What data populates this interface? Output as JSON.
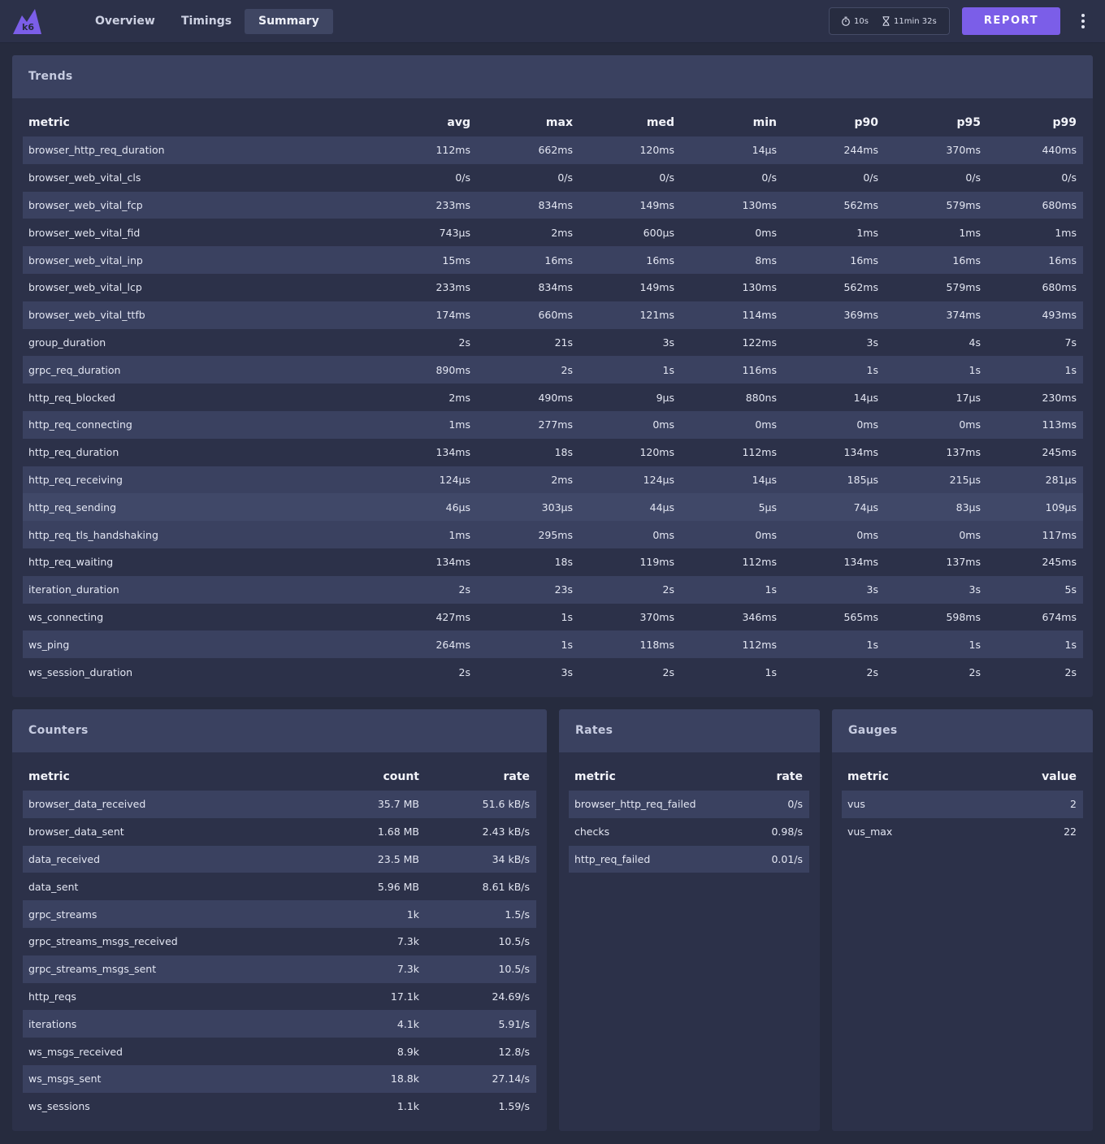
{
  "header": {
    "tabs": [
      "Overview",
      "Timings",
      "Summary"
    ],
    "active_tab": "Summary",
    "refresh_interval": "10s",
    "duration": "11min 32s",
    "report_label": "REPORT",
    "logo_text": "k6",
    "accent_color": "#7b5ee8"
  },
  "trends": {
    "title": "Trends",
    "columns": [
      "metric",
      "avg",
      "max",
      "med",
      "min",
      "p90",
      "p95",
      "p99"
    ],
    "rows": [
      [
        "browser_http_req_duration",
        "112ms",
        "662ms",
        "120ms",
        "14µs",
        "244ms",
        "370ms",
        "440ms"
      ],
      [
        "browser_web_vital_cls",
        "0/s",
        "0/s",
        "0/s",
        "0/s",
        "0/s",
        "0/s",
        "0/s"
      ],
      [
        "browser_web_vital_fcp",
        "233ms",
        "834ms",
        "149ms",
        "130ms",
        "562ms",
        "579ms",
        "680ms"
      ],
      [
        "browser_web_vital_fid",
        "743µs",
        "2ms",
        "600µs",
        "0ms",
        "1ms",
        "1ms",
        "1ms"
      ],
      [
        "browser_web_vital_inp",
        "15ms",
        "16ms",
        "16ms",
        "8ms",
        "16ms",
        "16ms",
        "16ms"
      ],
      [
        "browser_web_vital_lcp",
        "233ms",
        "834ms",
        "149ms",
        "130ms",
        "562ms",
        "579ms",
        "680ms"
      ],
      [
        "browser_web_vital_ttfb",
        "174ms",
        "660ms",
        "121ms",
        "114ms",
        "369ms",
        "374ms",
        "493ms"
      ],
      [
        "group_duration",
        "2s",
        "21s",
        "3s",
        "122ms",
        "3s",
        "4s",
        "7s"
      ],
      [
        "grpc_req_duration",
        "890ms",
        "2s",
        "1s",
        "116ms",
        "1s",
        "1s",
        "1s"
      ],
      [
        "http_req_blocked",
        "2ms",
        "490ms",
        "9µs",
        "880ns",
        "14µs",
        "17µs",
        "230ms"
      ],
      [
        "http_req_connecting",
        "1ms",
        "277ms",
        "0ms",
        "0ms",
        "0ms",
        "0ms",
        "113ms"
      ],
      [
        "http_req_duration",
        "134ms",
        "18s",
        "120ms",
        "112ms",
        "134ms",
        "137ms",
        "245ms"
      ],
      [
        "http_req_receiving",
        "124µs",
        "2ms",
        "124µs",
        "14µs",
        "185µs",
        "215µs",
        "281µs"
      ],
      [
        "http_req_sending",
        "46µs",
        "303µs",
        "44µs",
        "5µs",
        "74µs",
        "83µs",
        "109µs"
      ],
      [
        "http_req_tls_handshaking",
        "1ms",
        "295ms",
        "0ms",
        "0ms",
        "0ms",
        "0ms",
        "117ms"
      ],
      [
        "http_req_waiting",
        "134ms",
        "18s",
        "119ms",
        "112ms",
        "134ms",
        "137ms",
        "245ms"
      ],
      [
        "iteration_duration",
        "2s",
        "23s",
        "2s",
        "1s",
        "3s",
        "3s",
        "5s"
      ],
      [
        "ws_connecting",
        "427ms",
        "1s",
        "370ms",
        "346ms",
        "565ms",
        "598ms",
        "674ms"
      ],
      [
        "ws_ping",
        "264ms",
        "1s",
        "118ms",
        "112ms",
        "1s",
        "1s",
        "1s"
      ],
      [
        "ws_session_duration",
        "2s",
        "3s",
        "2s",
        "1s",
        "2s",
        "2s",
        "2s"
      ]
    ]
  },
  "counters": {
    "title": "Counters",
    "columns": [
      "metric",
      "count",
      "rate"
    ],
    "rows": [
      [
        "browser_data_received",
        "35.7 MB",
        "51.6 kB/s"
      ],
      [
        "browser_data_sent",
        "1.68 MB",
        "2.43 kB/s"
      ],
      [
        "data_received",
        "23.5 MB",
        "34 kB/s"
      ],
      [
        "data_sent",
        "5.96 MB",
        "8.61 kB/s"
      ],
      [
        "grpc_streams",
        "1k",
        "1.5/s"
      ],
      [
        "grpc_streams_msgs_received",
        "7.3k",
        "10.5/s"
      ],
      [
        "grpc_streams_msgs_sent",
        "7.3k",
        "10.5/s"
      ],
      [
        "http_reqs",
        "17.1k",
        "24.69/s"
      ],
      [
        "iterations",
        "4.1k",
        "5.91/s"
      ],
      [
        "ws_msgs_received",
        "8.9k",
        "12.8/s"
      ],
      [
        "ws_msgs_sent",
        "18.8k",
        "27.14/s"
      ],
      [
        "ws_sessions",
        "1.1k",
        "1.59/s"
      ]
    ]
  },
  "rates": {
    "title": "Rates",
    "columns": [
      "metric",
      "rate"
    ],
    "rows": [
      [
        "browser_http_req_failed",
        "0/s"
      ],
      [
        "checks",
        "0.98/s"
      ],
      [
        "http_req_failed",
        "0.01/s"
      ]
    ]
  },
  "gauges": {
    "title": "Gauges",
    "columns": [
      "metric",
      "value"
    ],
    "rows": [
      [
        "vus",
        "2"
      ],
      [
        "vus_max",
        "22"
      ]
    ]
  }
}
